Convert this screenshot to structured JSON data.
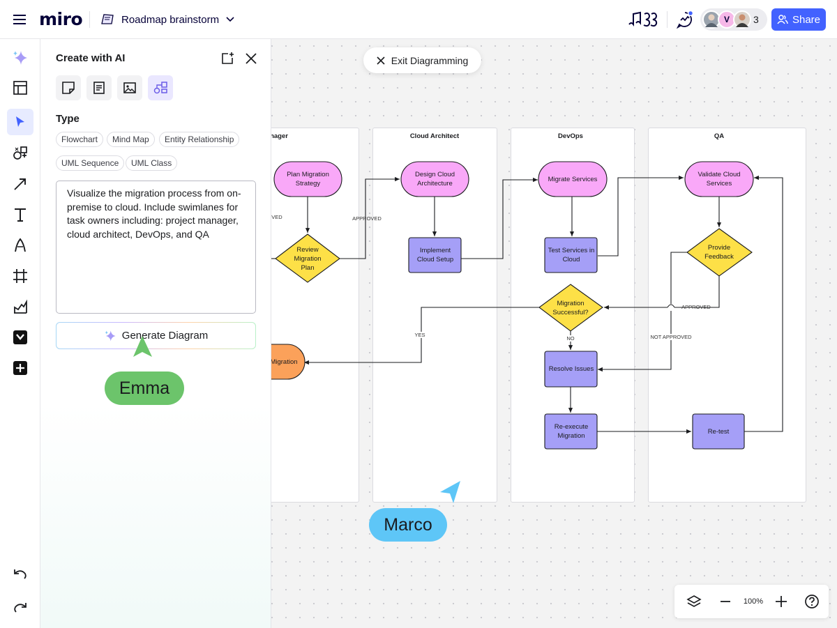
{
  "app": {
    "logo": "miro",
    "board_title": "Roadmap brainstorm",
    "share_label": "Share",
    "collaborator_count": "3",
    "avatar_initial": "V"
  },
  "panel": {
    "title": "Create with AI",
    "type_label": "Type",
    "chips": [
      "Flowchart",
      "Mind Map",
      "Entity Relationship",
      "UML Sequence",
      "UML Class"
    ],
    "prompt": "Visualize the migration process from on-premise to cloud. Include swimlanes for task owners including: project manager, cloud architect, DevOps, and QA",
    "generate_label": "Generate Diagram"
  },
  "exit_label": "Exit Diagramming",
  "diagram": {
    "lanes": [
      "nager",
      "Cloud Architect",
      "DevOps",
      "QA"
    ],
    "nodes": {
      "plan": "Plan Migration Strategy",
      "review": "Review Migration Plan",
      "design": "Design Cloud Architecture",
      "implement": "Implement Cloud Setup",
      "migrate": "Migrate Services",
      "test": "Test Services in Cloud",
      "success": "Migration Successful?",
      "resolve": "Resolve Issues",
      "reexecute": "Re-execute Migration",
      "validate": "Validate Cloud Services",
      "feedback": "Provide Feedback",
      "retest": "Re-test",
      "migration": "Migration"
    },
    "edges": {
      "approved_left": "OVED",
      "approved": "APPROVED",
      "approved_qa": "APPROVED",
      "not_approved": "NOT APPROVED",
      "yes": "YES",
      "no": "NO"
    }
  },
  "cursors": {
    "emma": "Emma",
    "marco": "Marco"
  },
  "zoom": {
    "level": "100%"
  },
  "colors": {
    "accent": "#4262ff",
    "pink_node": "#f9a8f8",
    "purple_node": "#a59ff7",
    "yellow_node": "#fde047",
    "orange_node": "#fba15a",
    "emma": "#6cc46b",
    "marco": "#5ec6f7"
  }
}
